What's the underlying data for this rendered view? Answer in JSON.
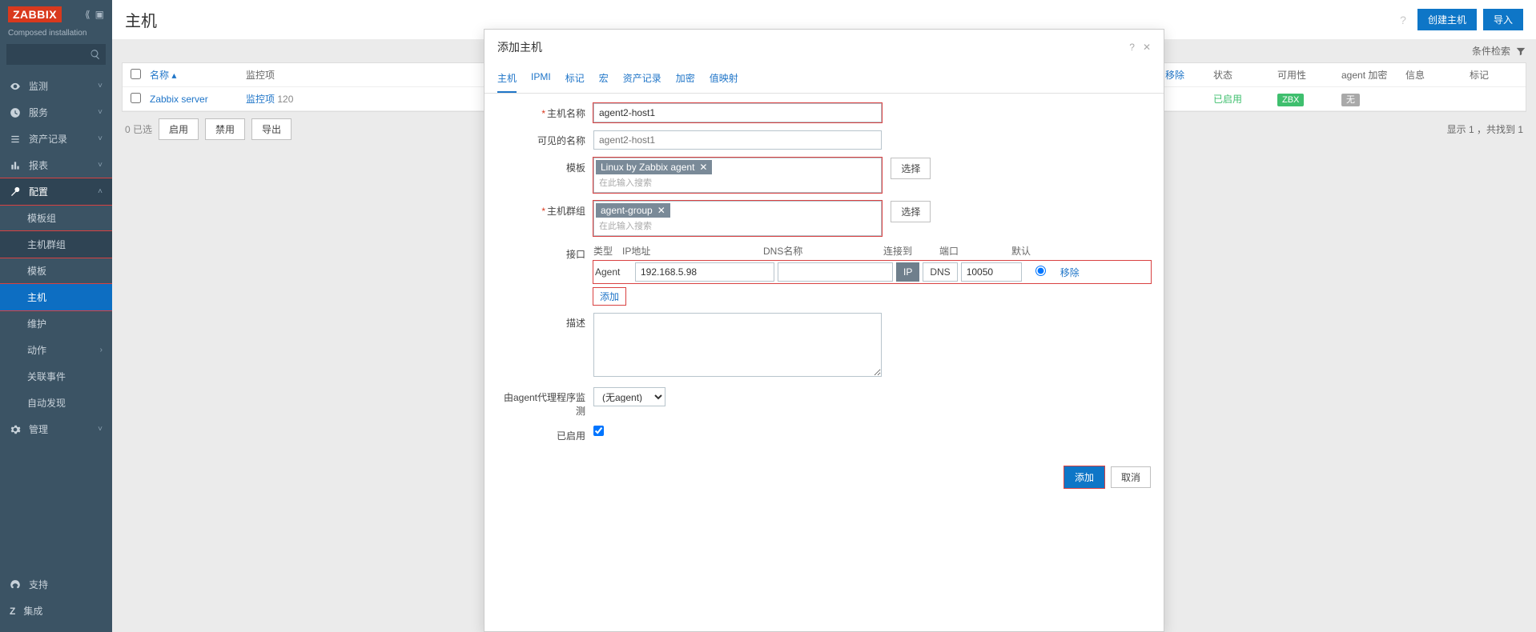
{
  "brand": "ZABBIX",
  "subLabel": "Composed installation",
  "nav": {
    "monitor": "监测",
    "service": "服务",
    "asset": "资产记录",
    "report": "报表",
    "config": "配置",
    "config_children": {
      "tplgroup": "模板组",
      "hostgroup": "主机群组",
      "template": "模板",
      "host": "主机",
      "maintenance": "维护",
      "action": "动作",
      "correlation": "关联事件",
      "discovery": "自动发现"
    },
    "admin": "管理",
    "support": "支持",
    "integration": "集成"
  },
  "page": {
    "title": "主机",
    "createBtn": "创建主机",
    "importBtn": "导入",
    "filterLabel": "条件检索"
  },
  "table": {
    "headers": {
      "name": "名称",
      "monitor": "监控项",
      "status": "状态",
      "avail": "可用性",
      "enc": "agent 加密",
      "info": "信息",
      "tag": "标记"
    },
    "rows": [
      {
        "name": "Zabbix server",
        "monitor": "监控项",
        "monitorCount": "120",
        "status": "已启用",
        "avail": "ZBX",
        "enc": "无"
      }
    ],
    "removeLabel": "移除",
    "footer": {
      "selected": "0 已选",
      "enable": "启用",
      "disable": "禁用",
      "export": "导出",
      "summary": "显示 1 ，共找到 1"
    }
  },
  "modal": {
    "title": "添加主机",
    "tabs": [
      "主机",
      "IPMI",
      "标记",
      "宏",
      "资产记录",
      "加密",
      "值映射"
    ],
    "labels": {
      "hostname": "主机名称",
      "visiblename": "可见的名称",
      "template": "模板",
      "group": "主机群组",
      "iface": "接口",
      "desc": "描述",
      "proxy": "由agent代理程序监测",
      "enabled": "已启用",
      "select": "选择",
      "searchPlaceholder": "在此输入搜索",
      "addIface": "添加"
    },
    "values": {
      "hostname": "agent2-host1",
      "visiblePlaceholder": "agent2-host1",
      "templateTag": "Linux by Zabbix agent",
      "groupTag": "agent-group",
      "proxy": "(无agent)"
    },
    "ifaceHead": {
      "type": "类型",
      "ip": "IP地址",
      "dns": "DNS名称",
      "conn": "连接到",
      "port": "端口",
      "def": "默认"
    },
    "iface": {
      "type": "Agent",
      "ip": "192.168.5.98",
      "dns": "",
      "connIP": "IP",
      "connDNS": "DNS",
      "port": "10050",
      "remove": "移除"
    },
    "footer": {
      "ok": "添加",
      "cancel": "取消"
    }
  }
}
